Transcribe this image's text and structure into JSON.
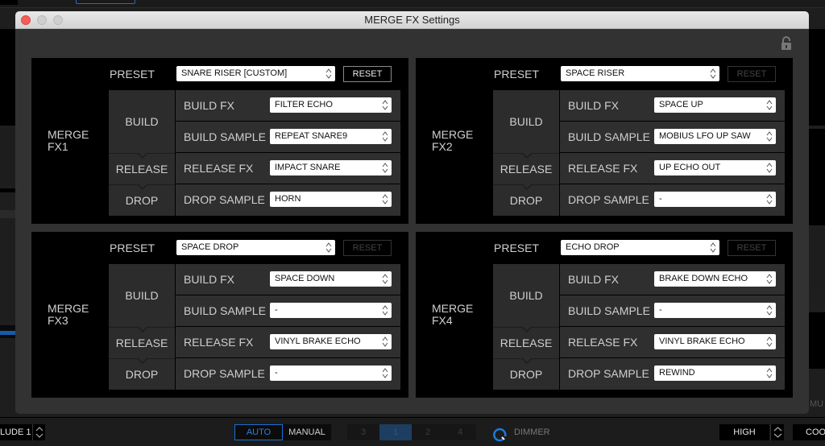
{
  "window": {
    "title": "MERGE FX Settings",
    "lock_icon": "unlocked-padlock-icon"
  },
  "labels": {
    "preset": "PRESET",
    "reset": "RESET",
    "build": "BUILD",
    "release": "RELEASE",
    "drop": "DROP",
    "build_fx": "BUILD FX",
    "build_sample": "BUILD SAMPLE",
    "release_fx": "RELEASE FX",
    "drop_sample": "DROP SAMPLE"
  },
  "panels": [
    {
      "name_line1": "MERGE",
      "name_line2": "FX1",
      "preset": "SNARE RISER [CUSTOM]",
      "reset_enabled": true,
      "build_fx": "FILTER ECHO",
      "build_sample": "REPEAT SNARE9",
      "release_fx": "IMPACT SNARE",
      "drop_sample": "HORN"
    },
    {
      "name_line1": "MERGE",
      "name_line2": "FX2",
      "preset": "SPACE RISER",
      "reset_enabled": false,
      "build_fx": "SPACE UP",
      "build_sample": "MOBIUS LFO UP SAW",
      "release_fx": "UP ECHO OUT",
      "drop_sample": "-"
    },
    {
      "name_line1": "MERGE",
      "name_line2": "FX3",
      "preset": "SPACE DROP",
      "reset_enabled": false,
      "build_fx": "SPACE DOWN",
      "build_sample": "-",
      "release_fx": "VINYL BRAKE ECHO",
      "drop_sample": "-"
    },
    {
      "name_line1": "MERGE",
      "name_line2": "FX4",
      "preset": "ECHO DROP",
      "reset_enabled": false,
      "build_fx": "BRAKE DOWN ECHO",
      "build_sample": "-",
      "release_fx": "VINYL BRAKE ECHO",
      "drop_sample": "REWIND"
    }
  ],
  "bottombar": {
    "prelude": "LUDE 1",
    "auto": "AUTO",
    "manual": "MANUAL",
    "deck_nums": [
      "3",
      "1",
      "2",
      "4"
    ],
    "dimmer": "DIMMER",
    "high": "HIGH",
    "cool": "COO",
    "mute": "MU"
  },
  "colors": {
    "accent_blue": "#1a6fd1",
    "close_red": "#f25f58"
  }
}
